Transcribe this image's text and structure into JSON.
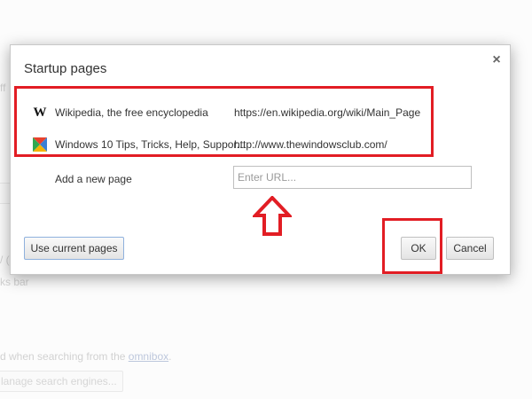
{
  "background": {
    "fragments": [
      "ff",
      "/ (",
      "ks bar"
    ],
    "search_text": "d when searching from the",
    "search_link": "omnibox",
    "search_suffix": ".",
    "manage_button": "lanage search engines..."
  },
  "dialog": {
    "title": "Startup pages",
    "close_glyph": "×",
    "pages": [
      {
        "favicon": "wikipedia-icon",
        "favicon_glyph": "W",
        "name": "Wikipedia, the free encyclopedia",
        "url": "https://en.wikipedia.org/wiki/Main_Page"
      },
      {
        "favicon": "windowsclub-icon",
        "name": "Windows 10 Tips, Tricks, Help, Suppor...",
        "url": "http://www.thewindowsclub.com/"
      }
    ],
    "add_label": "Add a new page",
    "url_placeholder": "Enter URL...",
    "url_value": "",
    "use_current_label": "Use current pages",
    "ok_label": "OK",
    "cancel_label": "Cancel"
  },
  "annotations": {
    "color": "#e21d24"
  }
}
